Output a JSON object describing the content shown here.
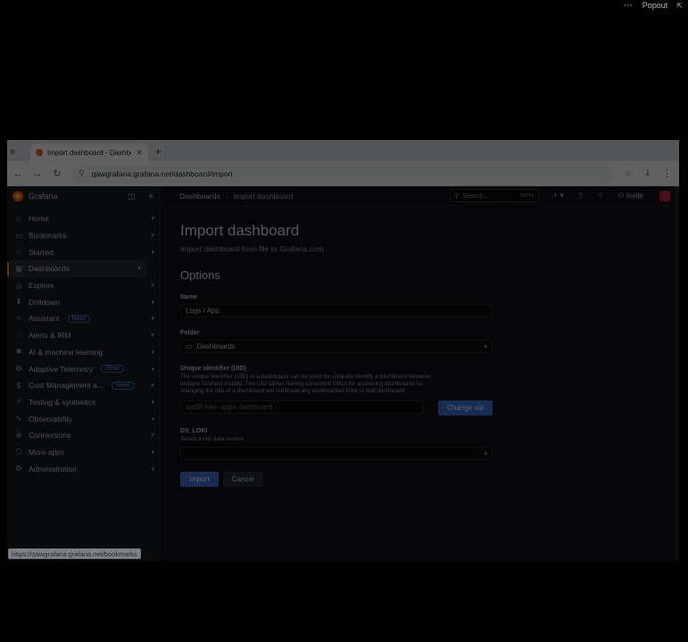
{
  "popout": {
    "label": "Popout"
  },
  "browser": {
    "tab_title": "Import dashboard - Dashboards",
    "url": "qawgrafana.grafana.net/dashboard/import",
    "status_url": "https://qawgrafana.grafana.net/bookmarks"
  },
  "app": {
    "brand": "Grafana",
    "menu": [
      {
        "label": "Home",
        "icon": "home-icon",
        "glyph": "⌂"
      },
      {
        "label": "Bookmarks",
        "icon": "bookmark-icon",
        "glyph": "▭"
      },
      {
        "label": "Starred",
        "icon": "star-icon",
        "glyph": "☆"
      },
      {
        "label": "Dashboards",
        "icon": "dashboards-icon",
        "glyph": "▦",
        "active": true
      },
      {
        "label": "Explore",
        "icon": "compass-icon",
        "glyph": "◎"
      },
      {
        "label": "Drilldown",
        "icon": "drilldown-icon",
        "glyph": "⬇"
      },
      {
        "label": "Assistant",
        "icon": "sparkle-icon",
        "glyph": "✧",
        "badge": "New!"
      },
      {
        "label": "Alerts & IRM",
        "icon": "bell-icon",
        "glyph": "♢"
      },
      {
        "label": "AI & machine learning",
        "icon": "brain-icon",
        "glyph": "✺"
      },
      {
        "label": "Adaptive Telemetry",
        "icon": "telemetry-icon",
        "glyph": "⚙",
        "badge": "New!"
      },
      {
        "label": "Cost Management a...",
        "icon": "cost-icon",
        "glyph": "$",
        "badge": "New!"
      },
      {
        "label": "Testing & synthetics",
        "icon": "testing-icon",
        "glyph": "⚡"
      },
      {
        "label": "Observability",
        "icon": "observability-icon",
        "glyph": "∿"
      },
      {
        "label": "Connections",
        "icon": "connections-icon",
        "glyph": "⊕"
      },
      {
        "label": "More apps",
        "icon": "apps-icon",
        "glyph": "⬡"
      },
      {
        "label": "Administration",
        "icon": "admin-icon",
        "glyph": "⚙"
      }
    ],
    "breadcrumb": {
      "root": "Dashboards",
      "current": "Import dashboard"
    },
    "search": {
      "placeholder": "Search...",
      "shortcut": "ctrl+k"
    },
    "invite": "Invite"
  },
  "page": {
    "title": "Import dashboard",
    "subtitle": "Import dashboard from file or Grafana.com",
    "section": "Options",
    "name_label": "Name",
    "name_value": "Logs / App",
    "folder_label": "Folder",
    "folder_value": "Dashboards",
    "uid_label": "Unique identifier (UID)",
    "uid_desc": "The unique identifier (UID) of a dashboard can be used for uniquely identify a dashboard between multiple Grafana installs. The UID allows having consistent URLs for accessing dashboards so changing the title of a dashboard will not break any bookmarked links to that dashboard.",
    "uid_value": "sadl8-loki--apps-dashboard",
    "change_uid": "Change uid",
    "ds_label": "DS_LOKI",
    "ds_desc": "Select a loki data source",
    "import": "Import",
    "cancel": "Cancel"
  }
}
